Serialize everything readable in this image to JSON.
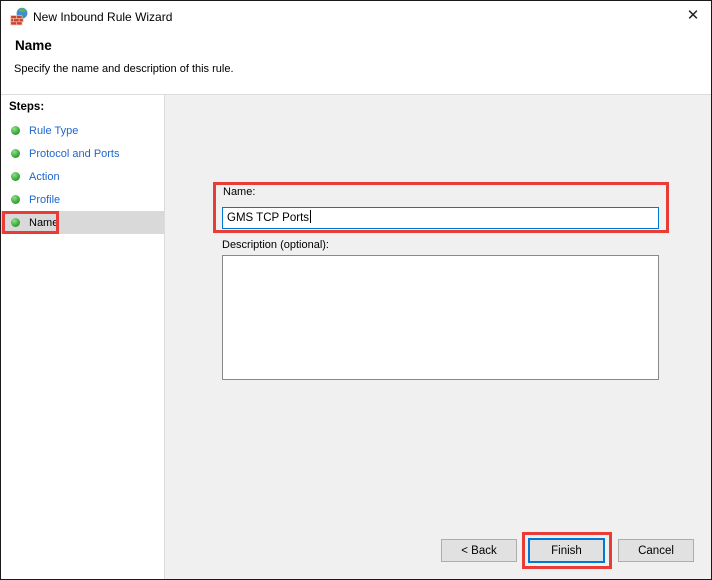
{
  "window": {
    "title": "New Inbound Rule Wizard",
    "app_icon": "firewall-icon",
    "close_glyph": "✕"
  },
  "header": {
    "title": "Name",
    "subtitle": "Specify the name and description of this rule."
  },
  "sidebar": {
    "heading": "Steps:",
    "steps": [
      {
        "label": "Rule Type",
        "active": false
      },
      {
        "label": "Protocol and Ports",
        "active": false
      },
      {
        "label": "Action",
        "active": false
      },
      {
        "label": "Profile",
        "active": false
      },
      {
        "label": "Name",
        "active": true
      }
    ]
  },
  "form": {
    "name_label": "Name:",
    "name_value": "GMS TCP Ports",
    "description_label": "Description (optional):",
    "description_value": ""
  },
  "buttons": {
    "back_label": "< Back",
    "finish_label": "Finish",
    "cancel_label": "Cancel"
  },
  "annotations": {
    "highlight_color": "#ea3c36",
    "highlighted_elements": [
      "sidebar-step-name",
      "rule-name-field",
      "finish-button"
    ]
  },
  "colors": {
    "focus_blue": "#0078d7",
    "link_blue": "#1f66cc",
    "bullet_green": "#2f9e2f",
    "main_background": "#f0f0f0",
    "selected_step_background": "#d9d9d9",
    "button_background": "#e1e1e1"
  }
}
